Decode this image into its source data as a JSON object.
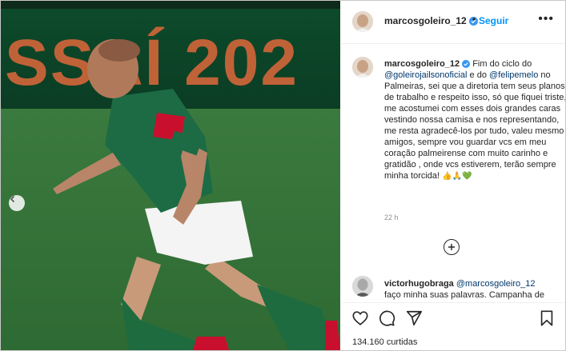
{
  "post": {
    "username": "marcosgoleiro_12",
    "follow_label": "Seguir",
    "separator": "•",
    "more_label": "•••",
    "photo": {
      "banner_text": "SSAÍ 202"
    },
    "caption": {
      "username": "marcosgoleiro_12",
      "text_1": " Fim do ciclo do ",
      "mention_1": "@goleirojailsonoficial",
      "text_2": " e do ",
      "mention_2": "@felipemelo",
      "text_3": " no Palmeiras, sei que a diretoria tem seus planos de trabalho e respeito isso, só que fiquei triste, me acostumei com esses dois grandes caras vestindo nossa camisa e nos representando, me resta agradecê-los por tudo, valeu mesmo amigos, sempre vou guardar vcs em meu coração palmeirense com muito carinho e gratidão , onde vcs estiverem, terão sempre minha torcida! ",
      "emojis": "👍🙏💚",
      "time": "22 h"
    },
    "comment": {
      "username": "victorhugobraga",
      "mention": "@marcosgoleiro_12",
      "text": "faço minha suas palavras. Campanha de"
    },
    "likes": "134.160 curtidas"
  },
  "colors": {
    "link_blue": "#0095f6",
    "mention_blue": "#00376b",
    "verified": "#3897f0",
    "muted": "#8e8e8e",
    "emoji_heart": "#2ea043"
  },
  "icons": [
    "verified-badge-icon",
    "more-options-icon",
    "add-comment-icon",
    "heart-icon",
    "comment-icon",
    "share-icon",
    "bookmark-icon",
    "carousel-prev-icon"
  ]
}
